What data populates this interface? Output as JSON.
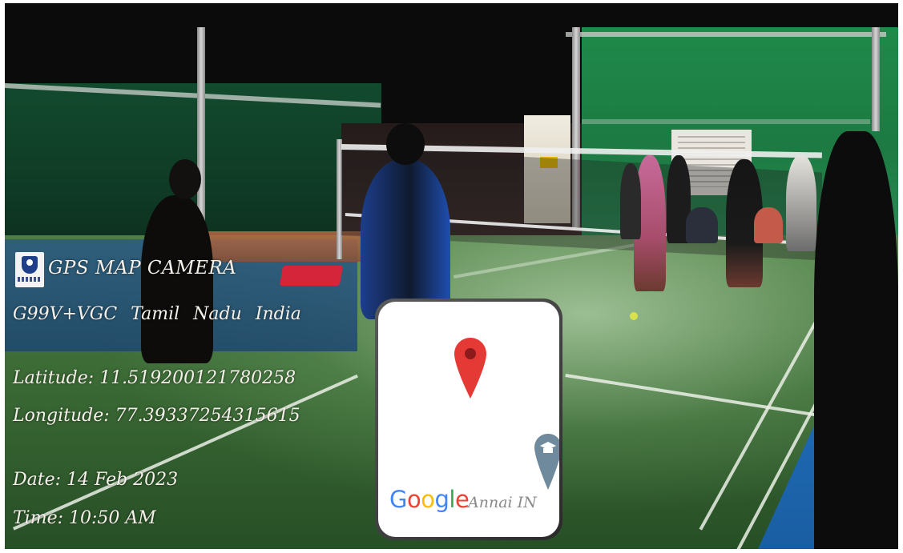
{
  "overlay": {
    "app_name": "GPS MAP CAMERA",
    "address": "G99V+VGC Tamil Nadu India",
    "latitude_text": "Latitude: 11.519200121780258",
    "longitude_text": "Longitude: 77.39337254315615",
    "date_text": "Date: 14 Feb 2023",
    "time_text": "Time: 10:50 AM"
  },
  "map": {
    "logo_text": "Google",
    "place_label": "Annai IN",
    "pin_icon": "location-pin-icon",
    "poi_icon": "school-poi-icon",
    "colors": {
      "google_blue": "#4285F4",
      "google_red": "#EA4335",
      "google_yellow": "#FBBC05",
      "google_green": "#34A853",
      "pin_red": "#E53935",
      "poi_grey": "#6f8a9c"
    }
  },
  "scene": {
    "description_free": true,
    "accent_colors": {
      "court_green": "#3b6a35",
      "wall_green": "#1f8a4a",
      "court_blue": "#1f6cb8",
      "mat_red": "#d4253a"
    }
  }
}
